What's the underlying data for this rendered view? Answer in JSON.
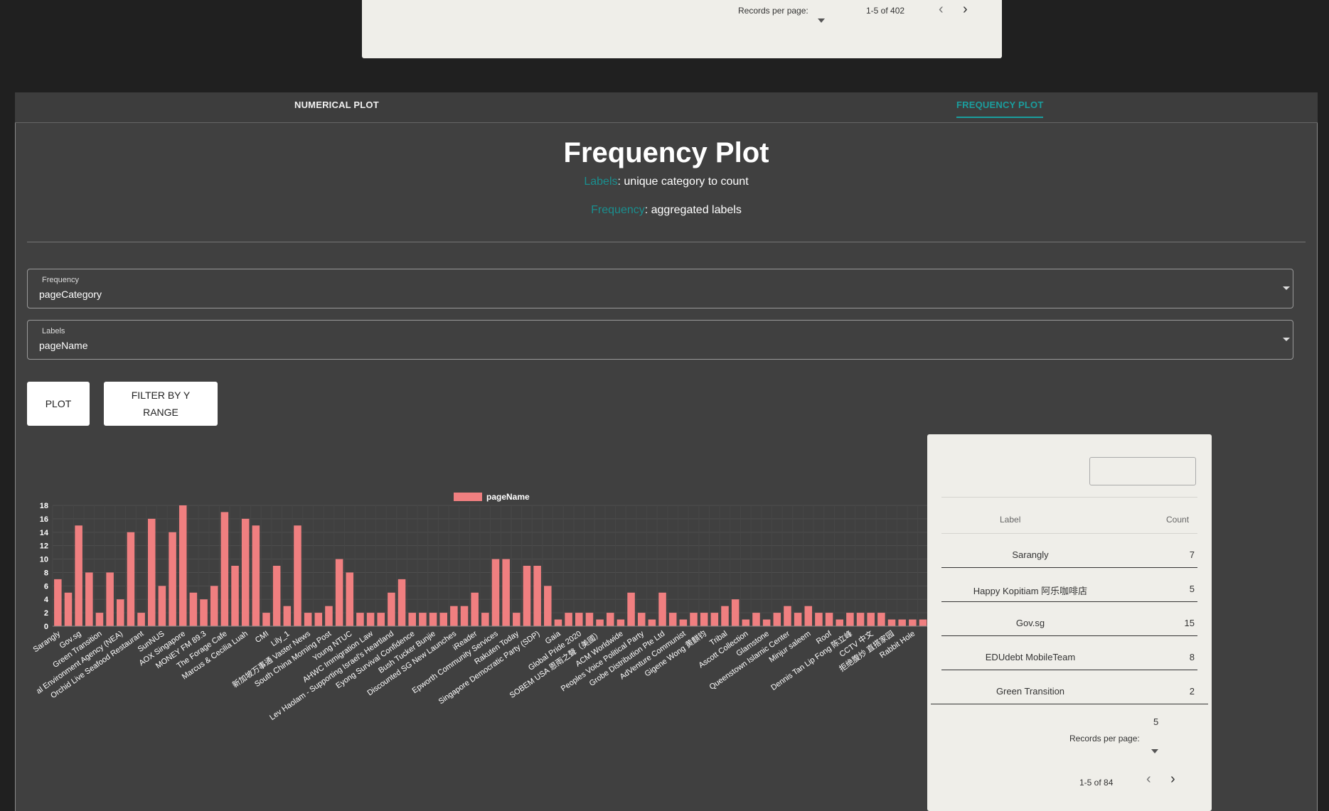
{
  "top_table": {
    "records_per_page_label": "Records per page:",
    "range_text": "1-5 of 402",
    "prev_icon": "‹",
    "next_icon": "›"
  },
  "tabs": [
    {
      "label": "NUMERICAL PLOT",
      "active": false
    },
    {
      "label": "FREQUENCY PLOT",
      "active": true
    }
  ],
  "header": {
    "title": "Frequency Plot",
    "labels_term": "Labels",
    "labels_desc": ": unique category to count",
    "frequency_term": "Frequency",
    "frequency_desc": ": aggregated labels"
  },
  "selects": {
    "frequency": {
      "label": "Frequency",
      "value": "pageCategory"
    },
    "labels": {
      "label": "Labels",
      "value": "pageName"
    }
  },
  "buttons": {
    "plot": "PLOT",
    "filter": "FILTER BY Y RANGE"
  },
  "colors": {
    "bar": "#f07f80",
    "accent": "#1a9e9e",
    "panel": "#404040"
  },
  "chart_data": {
    "type": "bar",
    "legend": [
      "pageName"
    ],
    "legend_position": "top-center",
    "grid": true,
    "ylim": [
      0,
      18
    ],
    "yticks": [
      0,
      2,
      4,
      6,
      8,
      10,
      12,
      14,
      16,
      18
    ],
    "series": [
      {
        "name": "pageName",
        "values": [
          7,
          5,
          15,
          8,
          2,
          8,
          4,
          14,
          2,
          16,
          6,
          14,
          18,
          5,
          4,
          6,
          17,
          9,
          16,
          15,
          2,
          9,
          3,
          15,
          2,
          2,
          3,
          10,
          8,
          2,
          2,
          2,
          5,
          7,
          2,
          2,
          2,
          2,
          3,
          3,
          5,
          2,
          10,
          10,
          2,
          9,
          9,
          6,
          1,
          2,
          2,
          2,
          1,
          2,
          1,
          5,
          2,
          1,
          5,
          2,
          1,
          2,
          2,
          2,
          3,
          4,
          1,
          2,
          1,
          2,
          3,
          2,
          3,
          2,
          2,
          1,
          2,
          2,
          2,
          2,
          1,
          1,
          1,
          1,
          1
        ]
      }
    ],
    "tick_labels": [
      "Sarangly",
      "Gov.sg",
      "Green Transition",
      "al Environment Agency (NEA)",
      "Orchid Live Seafood Restaurant",
      "SunNUS",
      "AOX Singapore",
      "MONEY FM 89.3",
      "The Forage Cafe",
      "Marcus & Cecilia Luah",
      "CMI",
      "Lily_1",
      "新加坡万事通 Vaster News",
      "South China Morning Post",
      "Young NTUC",
      "AHWC Immigration Law",
      "Lev Haolam - Supporting Israel's Heartland",
      "Eyong Survival Confidence",
      "Bush Tucker Bunjie",
      "Discounted SG New Launches",
      "iReader",
      "Epworth Community Services",
      "Rakuten Today",
      "Singapore Democratic Party (SDP)",
      "Gaia",
      "Global Pride 2020",
      "SOBEM USA 恩雨之聲（美國）",
      "ACM Worldwide",
      "Peoples Voice Political Party",
      "Grobe Distribution Pte Ltd",
      "AdVenture Communist",
      "Gigene Wong 黄麒钧",
      "Tribal",
      "Ascott Collection",
      "Glamstone",
      "Queenstown Islamic Center",
      "Minjur saleem",
      "Roof",
      "Dennis Tan Lip Fong 陈立峰",
      "CCTV 中文",
      "拒绝腹炒 直搭家园",
      "Rabbit Hole"
    ]
  },
  "side_table": {
    "columns": [
      "Label",
      "Count"
    ],
    "rows": [
      {
        "label": "Sarangly",
        "count": "7"
      },
      {
        "label": "Happy Kopitiam 阿乐咖啡店",
        "count": "5"
      },
      {
        "label": "Gov.sg",
        "count": "15"
      },
      {
        "label": "EDUdebt MobileTeam",
        "count": "8"
      },
      {
        "label": "Green Transition",
        "count": "2"
      }
    ],
    "per_page": "5",
    "records_per_page_label": "Records per page:",
    "range_text": "1-5 of 84",
    "prev_icon": "‹",
    "next_icon": "›"
  }
}
